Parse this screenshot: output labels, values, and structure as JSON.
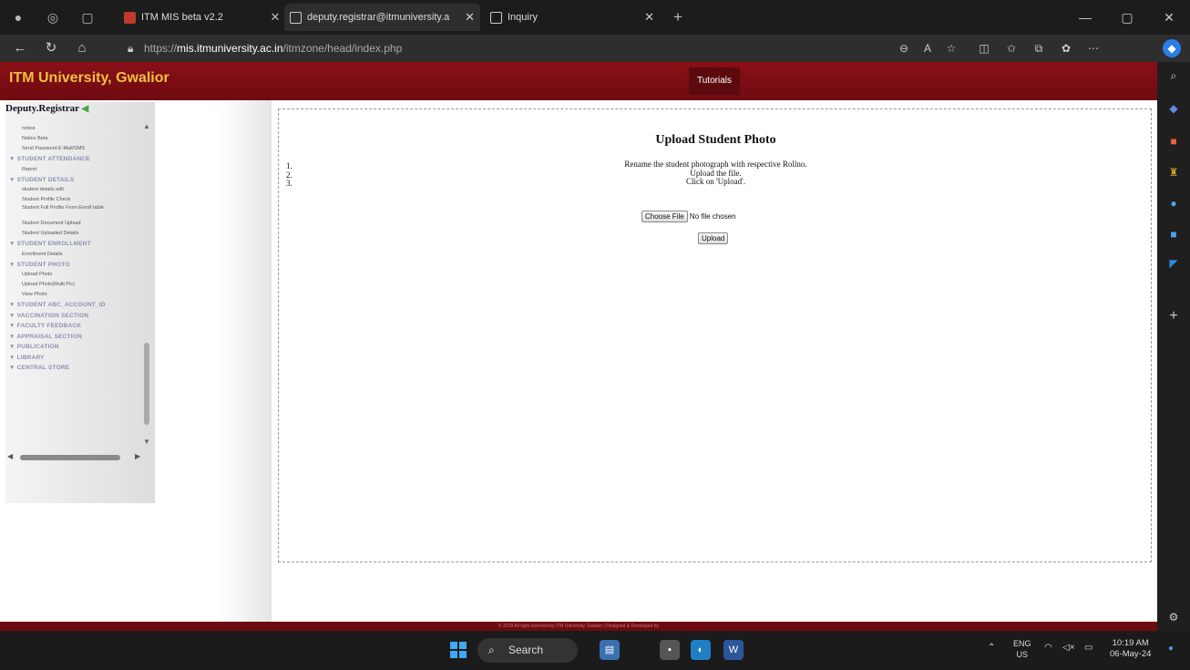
{
  "browser": {
    "tabs": [
      {
        "label": "ITM MIS beta v2.2",
        "active": false
      },
      {
        "label": "deputy.registrar@itmuniversity.a",
        "active": true
      },
      {
        "label": "Inquiry",
        "active": false
      }
    ],
    "url_prefix": "https://",
    "url_host": "mis.itmuniversity.ac.in",
    "url_path": "/itmzone/head/index.php"
  },
  "site": {
    "brand": "ITM University, Gwalior",
    "tutorials_label": "Tutorials"
  },
  "sidebar": {
    "user": "Deputy.Registrar",
    "items": [
      {
        "label": "notice",
        "type": "sub"
      },
      {
        "label": "Notice Beta",
        "type": "sub"
      },
      {
        "label": "Send Password E-Mail/SMS",
        "type": "sub"
      },
      {
        "label": "▼ STUDENT ATTENDANCE",
        "type": "sec"
      },
      {
        "label": "Report",
        "type": "sub"
      },
      {
        "label": "▼ STUDENT DETAILS",
        "type": "sec"
      },
      {
        "label": "student details edit",
        "type": "sub"
      },
      {
        "label": "Student Profile Check",
        "type": "sub"
      },
      {
        "label": "Student Full Profile From Enroll table",
        "type": "sub2"
      },
      {
        "label": "Student Document Upload",
        "type": "sub"
      },
      {
        "label": "Student Uploaded Details",
        "type": "sub"
      },
      {
        "label": "▼ STUDENT ENROLLMENT",
        "type": "sec"
      },
      {
        "label": "Enrollment Details",
        "type": "sub"
      },
      {
        "label": "▼ STUDENT PHOTO",
        "type": "sec"
      },
      {
        "label": "Upload Photo",
        "type": "sub"
      },
      {
        "label": "Upload Photo(Multi Pic)",
        "type": "sub"
      },
      {
        "label": "View Photo",
        "type": "sub"
      },
      {
        "label": "▼ STUDENT ABC_ACCOUNT_ID",
        "type": "sec"
      },
      {
        "label": "▼ VACCINATION SECTION",
        "type": "sec"
      },
      {
        "label": "▼ FACULTY FEEDBACK",
        "type": "sec"
      },
      {
        "label": "▼ APPRAISAL SECTION",
        "type": "sec"
      },
      {
        "label": "▼ PUBLICATION",
        "type": "sec"
      },
      {
        "label": "▼ LIBRARY",
        "type": "sec"
      },
      {
        "label": "▼ CENTRAL STORE",
        "type": "sec"
      }
    ]
  },
  "main": {
    "title": "Upload Student Photo",
    "steps": [
      "1.",
      "2.",
      "3."
    ],
    "instructions": [
      "Rename the student photograph with respective Rollno.",
      "Upload the file.",
      "Click on 'Upload'."
    ],
    "choose_file_label": "Choose File",
    "no_file_text": "No file chosen",
    "upload_label": "Upload"
  },
  "footer": {
    "text": "© 2018 All right reserved by ITM University, Gwalior | Designed & Developed by"
  },
  "taskbar": {
    "search_label": "Search",
    "lang_top": "ENG",
    "lang_bottom": "US",
    "time": "10:19 AM",
    "date": "06-May-24"
  }
}
